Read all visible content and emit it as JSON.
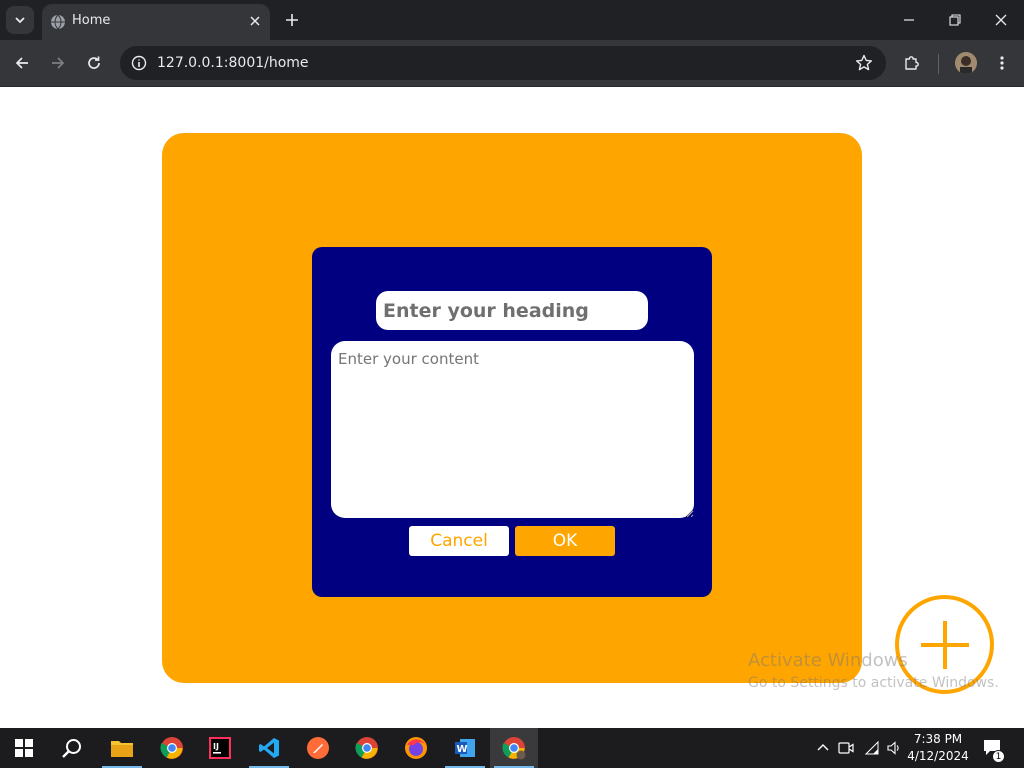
{
  "browser": {
    "tab": {
      "title": "Home"
    },
    "address_bar": {
      "url": "127.0.0.1:8001/home"
    }
  },
  "dialog": {
    "heading_placeholder": "Enter your heading",
    "content_placeholder": "Enter your content",
    "cancel_label": "Cancel",
    "ok_label": "OK"
  },
  "watermark": {
    "title": "Activate Windows",
    "subtitle": "Go to Settings to activate Windows."
  },
  "taskbar": {
    "apps": [
      "start-icon",
      "search-icon",
      "file-explorer-icon",
      "chrome-icon",
      "intellij-icon",
      "vscode-icon",
      "postman-icon",
      "chrome-icon",
      "firefox-icon",
      "word-icon",
      "chrome-active-icon"
    ],
    "clock": {
      "time": "7:38 PM",
      "date": "4/12/2024"
    },
    "notification_count": "1"
  },
  "colors": {
    "card": "#ffa500",
    "dialog": "#000080",
    "accent": "#ffa500"
  }
}
